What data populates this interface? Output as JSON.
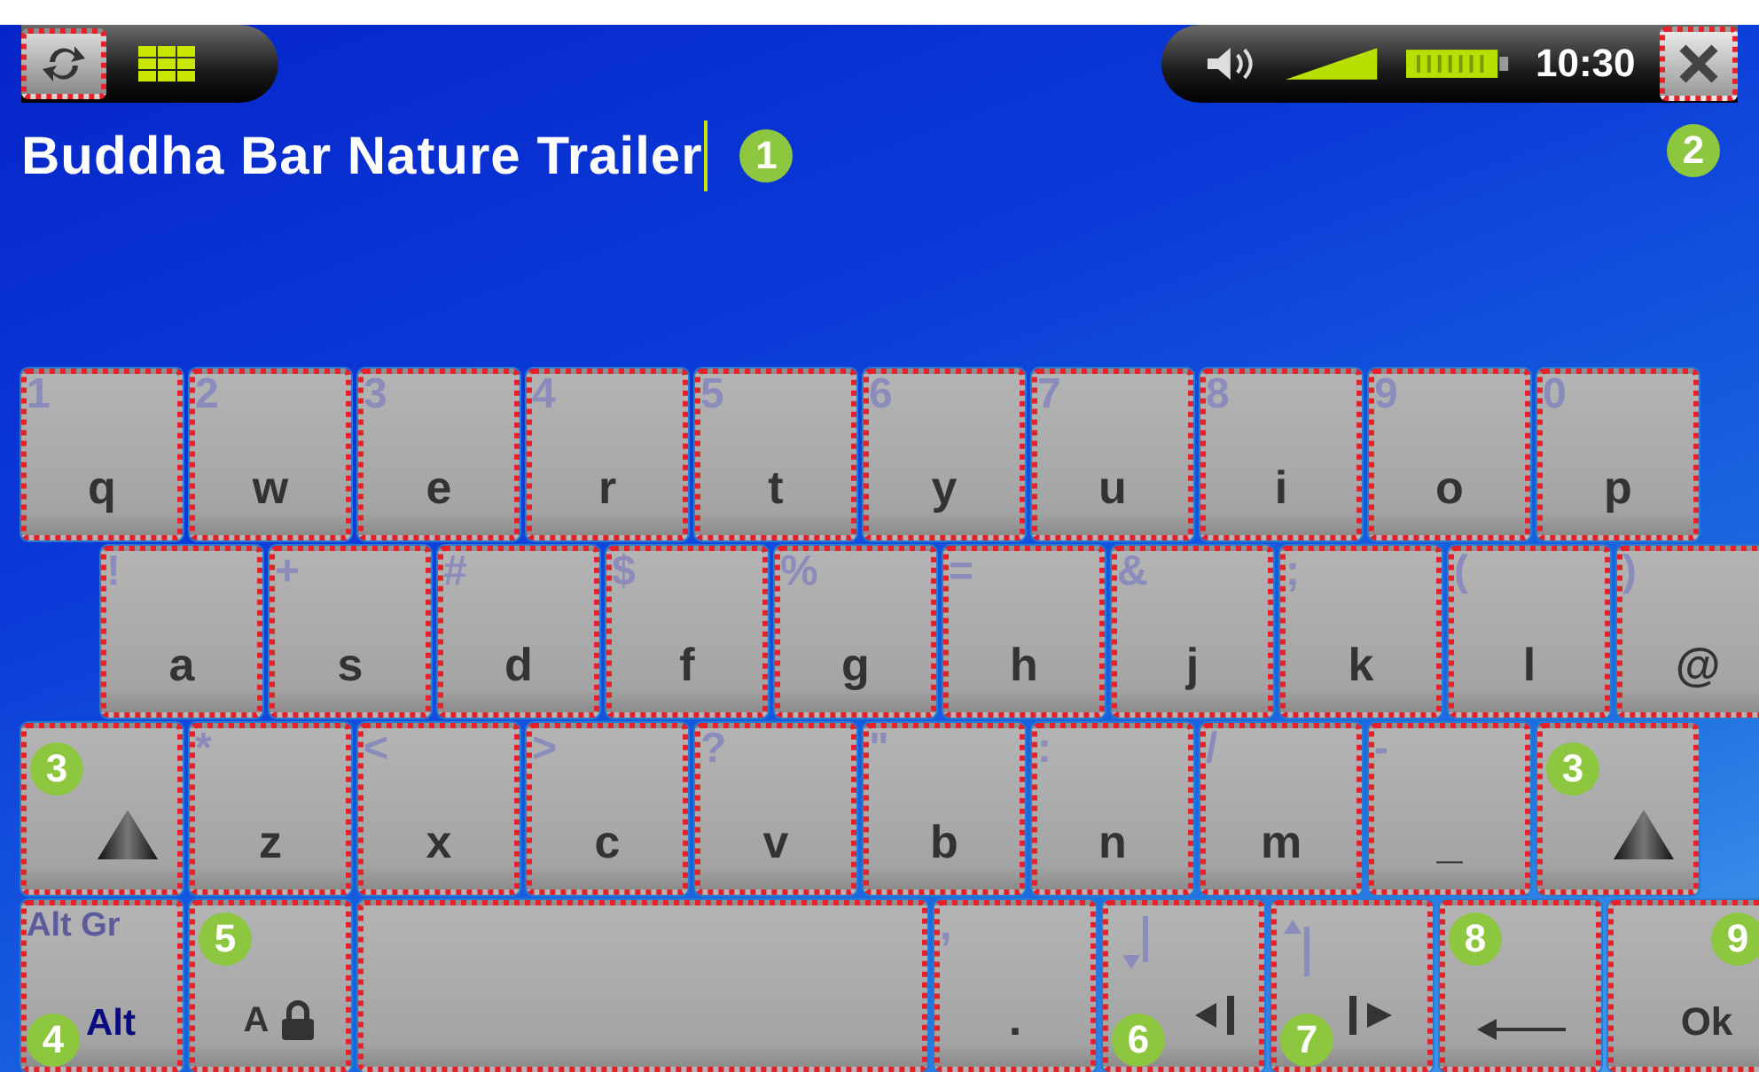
{
  "top_bar": {
    "left_buttons": [
      {
        "kind": "back",
        "highlighted": true
      },
      {
        "kind": "grid",
        "highlighted": false
      }
    ],
    "status": {
      "time": "10:30"
    },
    "close_button": {
      "highlighted": true,
      "callout": "2"
    }
  },
  "text_field": {
    "value": "Buddha Bar Nature Trailer",
    "callout": "1"
  },
  "keyboard": {
    "rows": [
      {
        "indent": false,
        "keys": [
          {
            "kind": "char",
            "label": "q",
            "alt": "1",
            "highlighted": true
          },
          {
            "kind": "char",
            "label": "w",
            "alt": "2",
            "highlighted": true
          },
          {
            "kind": "char",
            "label": "e",
            "alt": "3",
            "highlighted": true
          },
          {
            "kind": "char",
            "label": "r",
            "alt": "4",
            "highlighted": true
          },
          {
            "kind": "char",
            "label": "t",
            "alt": "5",
            "highlighted": true
          },
          {
            "kind": "char",
            "label": "y",
            "alt": "6",
            "highlighted": true
          },
          {
            "kind": "char",
            "label": "u",
            "alt": "7",
            "highlighted": true
          },
          {
            "kind": "char",
            "label": "i",
            "alt": "8",
            "highlighted": true
          },
          {
            "kind": "char",
            "label": "o",
            "alt": "9",
            "highlighted": true
          },
          {
            "kind": "char",
            "label": "p",
            "alt": "0",
            "highlighted": true
          }
        ]
      },
      {
        "indent": true,
        "keys": [
          {
            "kind": "char",
            "label": "a",
            "alt": "!",
            "highlighted": true
          },
          {
            "kind": "char",
            "label": "s",
            "alt": "+",
            "highlighted": true
          },
          {
            "kind": "char",
            "label": "d",
            "alt": "#",
            "highlighted": true
          },
          {
            "kind": "char",
            "label": "f",
            "alt": "$",
            "highlighted": true
          },
          {
            "kind": "char",
            "label": "g",
            "alt": "%",
            "highlighted": true
          },
          {
            "kind": "char",
            "label": "h",
            "alt": "=",
            "highlighted": true
          },
          {
            "kind": "char",
            "label": "j",
            "alt": "&",
            "highlighted": true
          },
          {
            "kind": "char",
            "label": "k",
            "alt": ";",
            "highlighted": true
          },
          {
            "kind": "char",
            "label": "l",
            "alt": "(",
            "highlighted": true
          },
          {
            "kind": "char",
            "label": "@",
            "alt": ")",
            "highlighted": true
          }
        ]
      },
      {
        "indent": false,
        "keys": [
          {
            "kind": "shift",
            "highlighted": true,
            "callout": "3"
          },
          {
            "kind": "char",
            "label": "z",
            "alt": "*",
            "highlighted": true
          },
          {
            "kind": "char",
            "label": "x",
            "alt": "<",
            "highlighted": true
          },
          {
            "kind": "char",
            "label": "c",
            "alt": ">",
            "highlighted": true
          },
          {
            "kind": "char",
            "label": "v",
            "alt": "?",
            "highlighted": true
          },
          {
            "kind": "char",
            "label": "b",
            "alt": "\"",
            "highlighted": true
          },
          {
            "kind": "char",
            "label": "n",
            "alt": ":",
            "highlighted": true
          },
          {
            "kind": "char",
            "label": "m",
            "alt": "/",
            "highlighted": true
          },
          {
            "kind": "char",
            "label": "_",
            "alt": "-",
            "highlighted": true
          },
          {
            "kind": "shift",
            "highlighted": true,
            "callout": "3"
          }
        ]
      },
      {
        "indent": false,
        "keys": [
          {
            "kind": "alt",
            "label": "Alt",
            "alt": "Alt Gr",
            "highlighted": true,
            "callout": "4"
          },
          {
            "kind": "caps",
            "label": "A",
            "highlighted": true,
            "callout": "5"
          },
          {
            "kind": "space",
            "highlighted": true
          },
          {
            "kind": "char",
            "label": ".",
            "alt": ",",
            "highlighted": true
          },
          {
            "kind": "left",
            "highlighted": true,
            "callout": "6"
          },
          {
            "kind": "right",
            "highlighted": true,
            "callout": "7"
          },
          {
            "kind": "backspace",
            "highlighted": true,
            "callout": "8"
          },
          {
            "kind": "ok",
            "label": "Ok",
            "highlighted": true,
            "callout": "9"
          }
        ]
      }
    ]
  }
}
